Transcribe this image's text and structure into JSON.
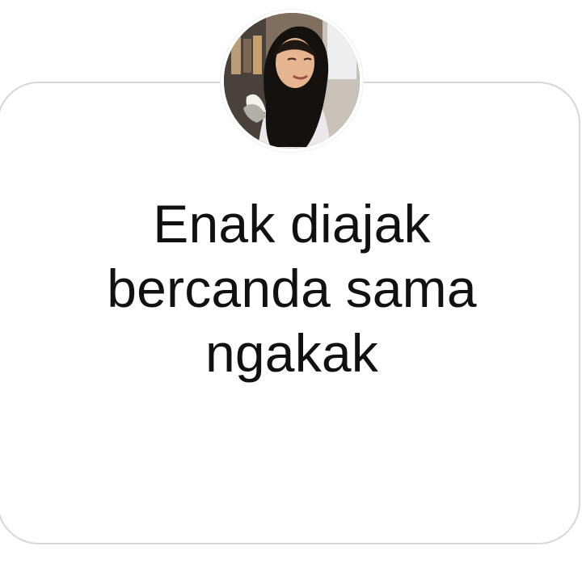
{
  "question_sticker": {
    "avatar": "profile-photo",
    "text": "Enak diajak\nbercanda sama\nngakak"
  },
  "colors": {
    "background": "#ffffff",
    "card_border": "#d7d7d7",
    "text": "#111111"
  }
}
